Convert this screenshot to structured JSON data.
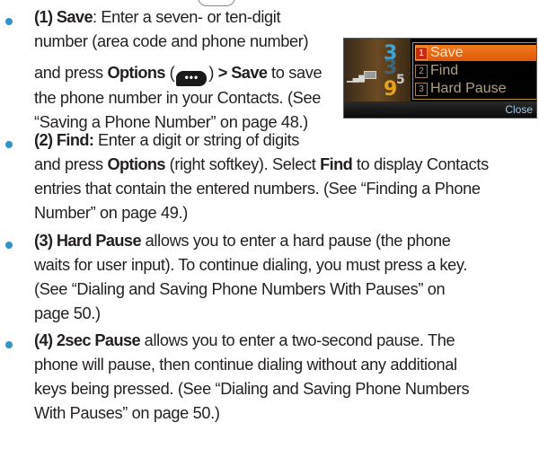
{
  "colors": {
    "bullet": "#2e95c9",
    "text": "#231f20",
    "menu_highlight": "#f07a1e"
  },
  "items": [
    {
      "label": "(1) Save",
      "lines": [
        ": Enter a seven- or ten-digit",
        "number (area code and phone number)",
        "and press ",
        "Options",
        " (",
        ") ",
        "> Save",
        " to save",
        "the phone number in your Contacts. (See",
        "“Saving a Phone Number” on page 48.)"
      ]
    },
    {
      "label": "(2) Find:",
      "lines": [
        " Enter a digit or string of digits",
        "and press ",
        "Options",
        " (right softkey). Select ",
        "Find",
        " to display Contacts",
        "entries that contain the entered numbers. (See “Finding a Phone",
        "Number” on page 49.)"
      ]
    },
    {
      "label": "(3) Hard Pause",
      "lines": [
        " allows you to enter a hard pause (the phone",
        "waits for user input). To continue dialing, you must press a key.",
        "(See “Dialing and Saving Phone Numbers With Pauses” on",
        "page 50.)"
      ]
    },
    {
      "label": "(4) 2sec Pause",
      "lines": [
        " allows you to enter a two-second pause. The",
        "phone will pause, then continue dialing without any additional",
        "keys being pressed. (See “Dialing and Saving Phone Numbers",
        "With Pauses” on page 50.)"
      ]
    }
  ],
  "softkey_icon": {
    "icon": "options-softkey-icon",
    "glyph": "•••"
  },
  "phone_screen": {
    "digits": [
      "3",
      "3",
      "9",
      "5"
    ],
    "menu": [
      {
        "num": "1",
        "label": "Save",
        "selected": true
      },
      {
        "num": "2",
        "label": "Find",
        "selected": false
      },
      {
        "num": "3",
        "label": "Hard Pause",
        "selected": false
      }
    ],
    "softkey_right": "Close"
  }
}
